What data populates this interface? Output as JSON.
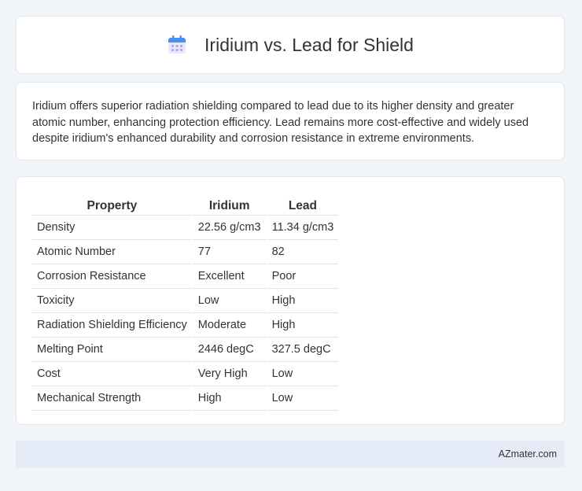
{
  "header": {
    "title": "Iridium vs. Lead for Shield",
    "icon": "calendar-icon"
  },
  "intro": {
    "text": "Iridium offers superior radiation shielding compared to lead due to its higher density and greater atomic number, enhancing protection efficiency. Lead remains more cost-effective and widely used despite iridium's enhanced durability and corrosion resistance in extreme environments."
  },
  "table": {
    "headers": [
      "Property",
      "Iridium",
      "Lead"
    ],
    "rows": [
      [
        "Density",
        "22.56 g/cm3",
        "11.34 g/cm3"
      ],
      [
        "Atomic Number",
        "77",
        "82"
      ],
      [
        "Corrosion Resistance",
        "Excellent",
        "Poor"
      ],
      [
        "Toxicity",
        "Low",
        "High"
      ],
      [
        "Radiation Shielding Efficiency",
        "Moderate",
        "High"
      ],
      [
        "Melting Point",
        "2446 degC",
        "327.5 degC"
      ],
      [
        "Cost",
        "Very High",
        "Low"
      ],
      [
        "Mechanical Strength",
        "High",
        "Low"
      ]
    ]
  },
  "footer": {
    "site": "AZmater.com"
  }
}
